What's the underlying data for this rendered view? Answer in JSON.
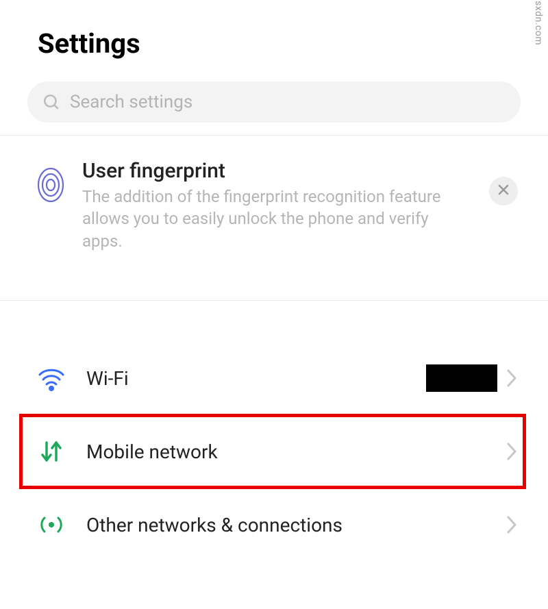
{
  "header": {
    "title": "Settings"
  },
  "search": {
    "placeholder": "Search settings"
  },
  "promo": {
    "title": "User fingerprint",
    "desc": "The addition of the fingerprint recognition feature allows you to easily unlock the phone and verify apps."
  },
  "rows": {
    "wifi": {
      "label": "Wi-Fi"
    },
    "mobile": {
      "label": "Mobile network"
    },
    "other": {
      "label": "Other networks & connections"
    }
  },
  "watermark": "wsxdn.com"
}
